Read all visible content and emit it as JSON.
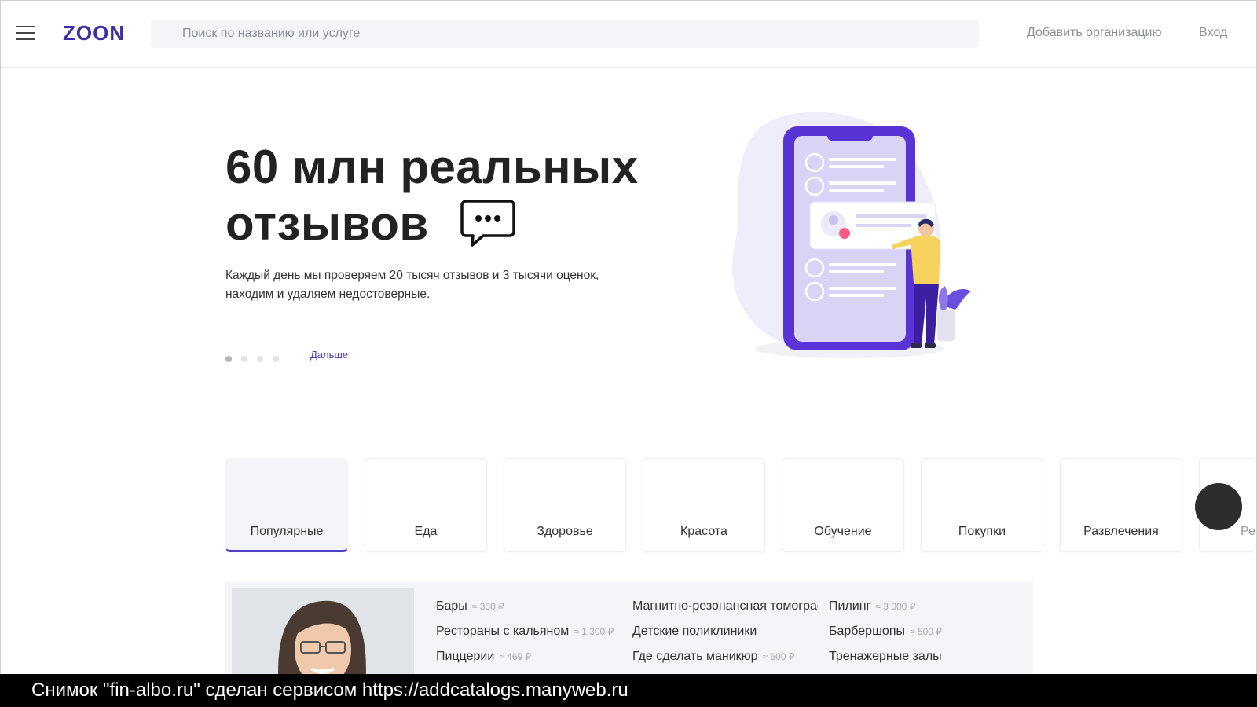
{
  "header": {
    "logo": "ZOON",
    "search_placeholder": "Поиск по названию или услуге",
    "add_org": "Добавить организацию",
    "login": "Вход"
  },
  "hero": {
    "title_line1": "60 млн реальных",
    "title_line2": "отзывов",
    "desc_line1": "Каждый день мы проверяем 20 тысяч отзывов и 3 тысячи оценок,",
    "desc_line2": "находим и удаляем недостоверные.",
    "next_label": "Дальше",
    "slides_total": 4,
    "slide_active": 1
  },
  "categories": [
    {
      "label": "Популярные",
      "active": true
    },
    {
      "label": "Еда"
    },
    {
      "label": "Здоровье"
    },
    {
      "label": "Красота"
    },
    {
      "label": "Обучение"
    },
    {
      "label": "Покупки"
    },
    {
      "label": "Развлечения"
    },
    {
      "label": "Ре"
    }
  ],
  "popular": {
    "col1": [
      {
        "name": "Бары",
        "price": "≈ 350 ₽"
      },
      {
        "name": "Рестораны с кальяном",
        "price": "≈ 1 300 ₽"
      },
      {
        "name": "Пиццерии",
        "price": "≈ 469 ₽"
      }
    ],
    "col2": [
      {
        "name": "Магнитно-резонансная томография",
        "price": ""
      },
      {
        "name": "Детские поликлиники",
        "price": ""
      },
      {
        "name": "Где сделать маникюр",
        "price": "≈ 600 ₽"
      }
    ],
    "col3": [
      {
        "name": "Пилинг",
        "price": "≈ 3 000 ₽"
      },
      {
        "name": "Барбершопы",
        "price": "≈ 500 ₽"
      },
      {
        "name": "Тренажерные залы",
        "price": ""
      }
    ]
  },
  "caption": "Снимок \"fin-albo.ru\" сделан сервисом https://addcatalogs.manyweb.ru",
  "colors": {
    "brand": "#3a2fa8",
    "accent": "#4d3fc4",
    "panel_bg": "#f3f5f8"
  }
}
